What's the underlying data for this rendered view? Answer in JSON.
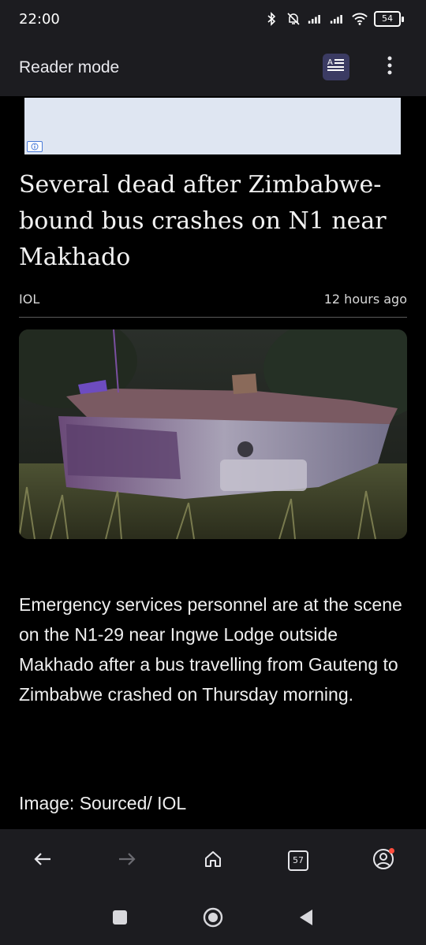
{
  "status_bar": {
    "time": "22:00",
    "battery": "54"
  },
  "app_bar": {
    "title": "Reader mode"
  },
  "article": {
    "headline": "Several dead after Zimbabwe-bound bus crashes on N1 near Makhado",
    "source": "IOL",
    "time_ago": "12 hours ago",
    "paragraph": "Emergency services personnel are at the scene on the N1-29 near Ingwe Lodge outside Makhado after a bus travelling from Gauteng to Zimbabwe crashed on Thursday morning.",
    "caption": "Image: Sourced/ IOL"
  },
  "bottom_bar": {
    "tab_count": "57"
  },
  "icons": {
    "status": [
      "bluetooth-icon",
      "silent-icon",
      "signal-icon",
      "signal-icon",
      "wifi-icon",
      "battery-icon"
    ],
    "app_bar": [
      "reader-mode-icon",
      "more-vert-icon"
    ],
    "bottom": [
      "back-icon",
      "forward-icon",
      "home-icon",
      "tabs-icon",
      "account-icon"
    ],
    "system": [
      "recents-icon",
      "home-circle-icon",
      "back-triangle-icon"
    ]
  },
  "colors": {
    "background": "#000000",
    "bar": "#1c1c20",
    "reader_button": "#3b3b63",
    "notification": "#ff4d3d"
  }
}
